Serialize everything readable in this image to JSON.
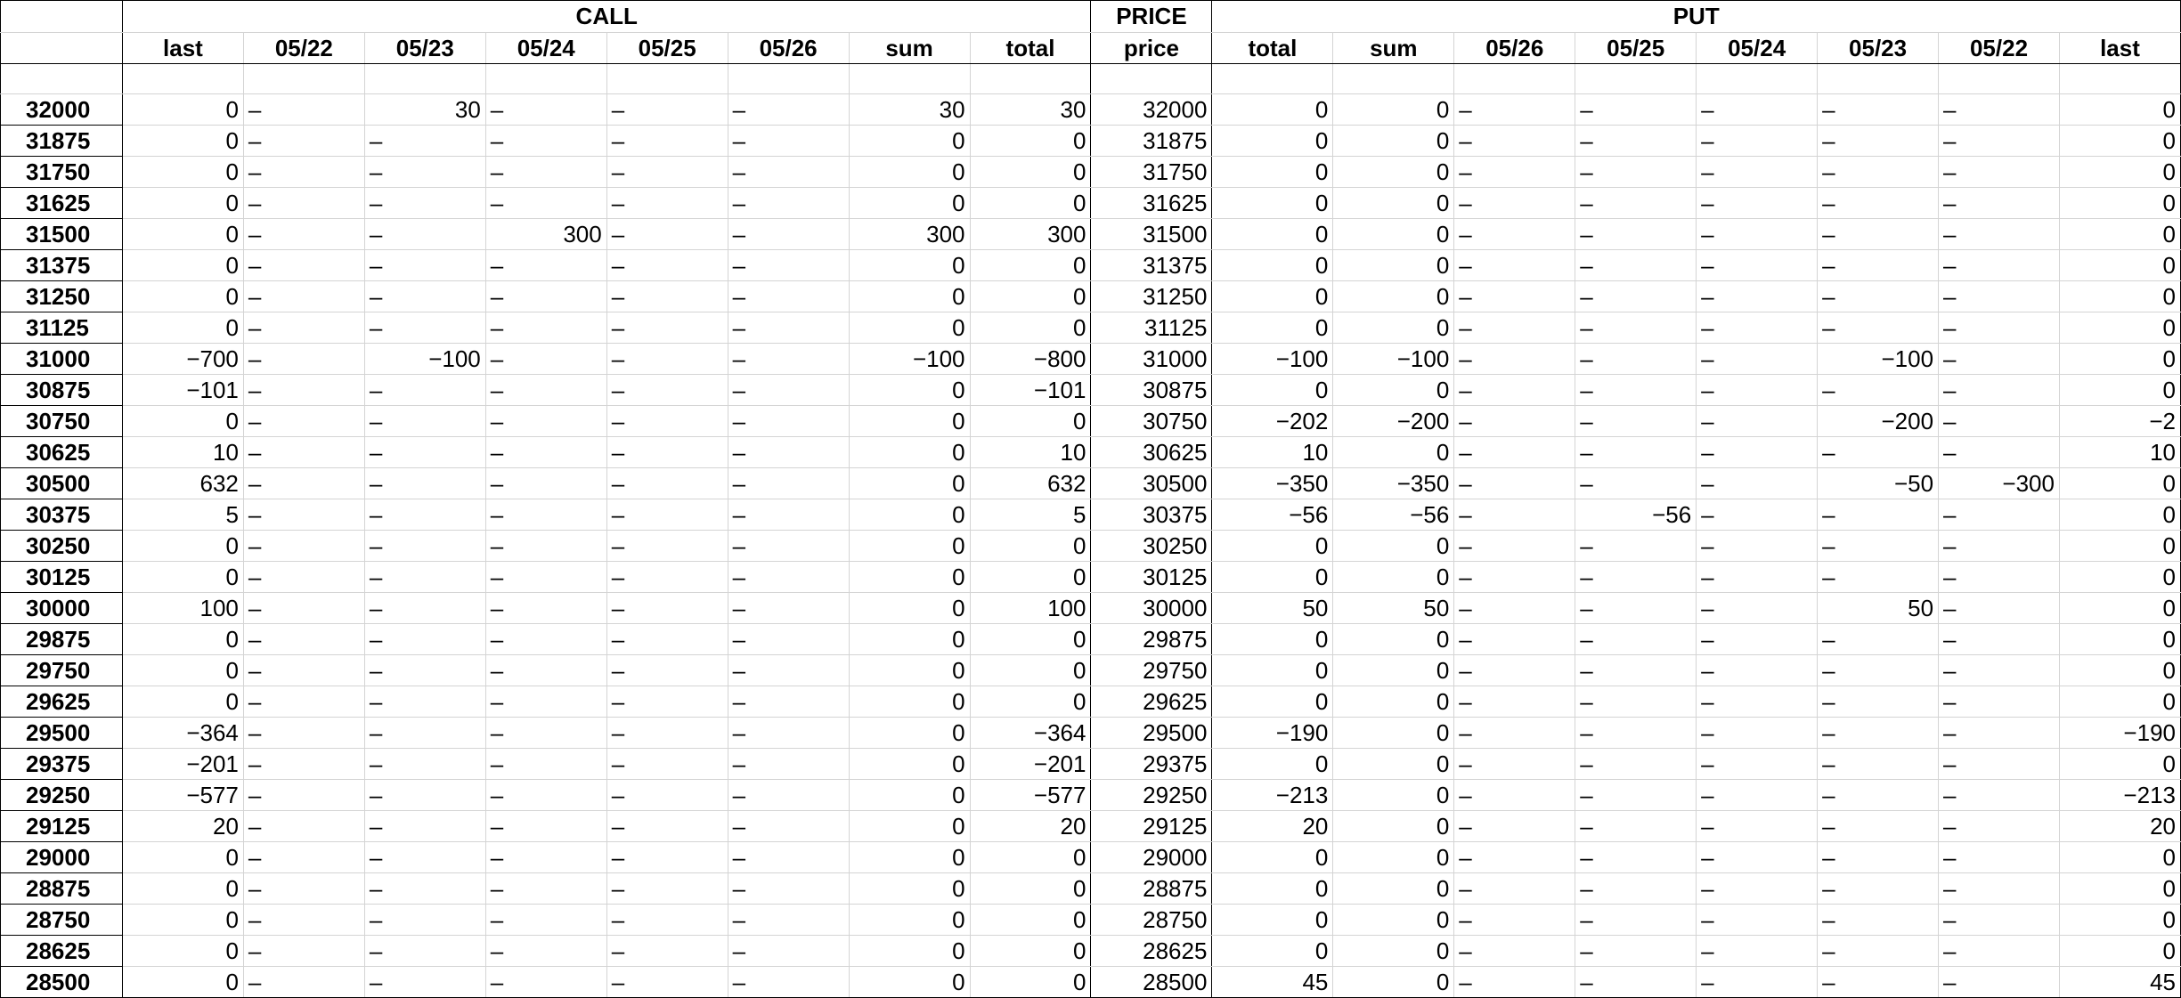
{
  "header": {
    "call_label": "CALL",
    "price_label": "PRICE",
    "put_label": "PUT"
  },
  "columns": [
    "",
    "last",
    "05/22",
    "05/23",
    "05/24",
    "05/25",
    "05/26",
    "sum",
    "total",
    "price",
    "total",
    "sum",
    "05/26",
    "05/25",
    "05/24",
    "05/23",
    "05/22",
    "last"
  ],
  "dash": "–",
  "rows": [
    [
      "32000",
      "0",
      "–",
      "30",
      "–",
      "–",
      "–",
      "30",
      "30",
      "32000",
      "0",
      "0",
      "–",
      "–",
      "–",
      "–",
      "–",
      "0"
    ],
    [
      "31875",
      "0",
      "–",
      "–",
      "–",
      "–",
      "–",
      "0",
      "0",
      "31875",
      "0",
      "0",
      "–",
      "–",
      "–",
      "–",
      "–",
      "0"
    ],
    [
      "31750",
      "0",
      "–",
      "–",
      "–",
      "–",
      "–",
      "0",
      "0",
      "31750",
      "0",
      "0",
      "–",
      "–",
      "–",
      "–",
      "–",
      "0"
    ],
    [
      "31625",
      "0",
      "–",
      "–",
      "–",
      "–",
      "–",
      "0",
      "0",
      "31625",
      "0",
      "0",
      "–",
      "–",
      "–",
      "–",
      "–",
      "0"
    ],
    [
      "31500",
      "0",
      "–",
      "–",
      "300",
      "–",
      "–",
      "300",
      "300",
      "31500",
      "0",
      "0",
      "–",
      "–",
      "–",
      "–",
      "–",
      "0"
    ],
    [
      "31375",
      "0",
      "–",
      "–",
      "–",
      "–",
      "–",
      "0",
      "0",
      "31375",
      "0",
      "0",
      "–",
      "–",
      "–",
      "–",
      "–",
      "0"
    ],
    [
      "31250",
      "0",
      "–",
      "–",
      "–",
      "–",
      "–",
      "0",
      "0",
      "31250",
      "0",
      "0",
      "–",
      "–",
      "–",
      "–",
      "–",
      "0"
    ],
    [
      "31125",
      "0",
      "–",
      "–",
      "–",
      "–",
      "–",
      "0",
      "0",
      "31125",
      "0",
      "0",
      "–",
      "–",
      "–",
      "–",
      "–",
      "0"
    ],
    [
      "31000",
      "−700",
      "–",
      "−100",
      "–",
      "–",
      "–",
      "−100",
      "−800",
      "31000",
      "−100",
      "−100",
      "–",
      "–",
      "–",
      "−100",
      "–",
      "0"
    ],
    [
      "30875",
      "−101",
      "–",
      "–",
      "–",
      "–",
      "–",
      "0",
      "−101",
      "30875",
      "0",
      "0",
      "–",
      "–",
      "–",
      "–",
      "–",
      "0"
    ],
    [
      "30750",
      "0",
      "–",
      "–",
      "–",
      "–",
      "–",
      "0",
      "0",
      "30750",
      "−202",
      "−200",
      "–",
      "–",
      "–",
      "−200",
      "–",
      "−2"
    ],
    [
      "30625",
      "10",
      "–",
      "–",
      "–",
      "–",
      "–",
      "0",
      "10",
      "30625",
      "10",
      "0",
      "–",
      "–",
      "–",
      "–",
      "–",
      "10"
    ],
    [
      "30500",
      "632",
      "–",
      "–",
      "–",
      "–",
      "–",
      "0",
      "632",
      "30500",
      "−350",
      "−350",
      "–",
      "–",
      "–",
      "−50",
      "−300",
      "0"
    ],
    [
      "30375",
      "5",
      "–",
      "–",
      "–",
      "–",
      "–",
      "0",
      "5",
      "30375",
      "−56",
      "−56",
      "–",
      "−56",
      "–",
      "–",
      "–",
      "0"
    ],
    [
      "30250",
      "0",
      "–",
      "–",
      "–",
      "–",
      "–",
      "0",
      "0",
      "30250",
      "0",
      "0",
      "–",
      "–",
      "–",
      "–",
      "–",
      "0"
    ],
    [
      "30125",
      "0",
      "–",
      "–",
      "–",
      "–",
      "–",
      "0",
      "0",
      "30125",
      "0",
      "0",
      "–",
      "–",
      "–",
      "–",
      "–",
      "0"
    ],
    [
      "30000",
      "100",
      "–",
      "–",
      "–",
      "–",
      "–",
      "0",
      "100",
      "30000",
      "50",
      "50",
      "–",
      "–",
      "–",
      "50",
      "–",
      "0"
    ],
    [
      "29875",
      "0",
      "–",
      "–",
      "–",
      "–",
      "–",
      "0",
      "0",
      "29875",
      "0",
      "0",
      "–",
      "–",
      "–",
      "–",
      "–",
      "0"
    ],
    [
      "29750",
      "0",
      "–",
      "–",
      "–",
      "–",
      "–",
      "0",
      "0",
      "29750",
      "0",
      "0",
      "–",
      "–",
      "–",
      "–",
      "–",
      "0"
    ],
    [
      "29625",
      "0",
      "–",
      "–",
      "–",
      "–",
      "–",
      "0",
      "0",
      "29625",
      "0",
      "0",
      "–",
      "–",
      "–",
      "–",
      "–",
      "0"
    ],
    [
      "29500",
      "−364",
      "–",
      "–",
      "–",
      "–",
      "–",
      "0",
      "−364",
      "29500",
      "−190",
      "0",
      "–",
      "–",
      "–",
      "–",
      "–",
      "−190"
    ],
    [
      "29375",
      "−201",
      "–",
      "–",
      "–",
      "–",
      "–",
      "0",
      "−201",
      "29375",
      "0",
      "0",
      "–",
      "–",
      "–",
      "–",
      "–",
      "0"
    ],
    [
      "29250",
      "−577",
      "–",
      "–",
      "–",
      "–",
      "–",
      "0",
      "−577",
      "29250",
      "−213",
      "0",
      "–",
      "–",
      "–",
      "–",
      "–",
      "−213"
    ],
    [
      "29125",
      "20",
      "–",
      "–",
      "–",
      "–",
      "–",
      "0",
      "20",
      "29125",
      "20",
      "0",
      "–",
      "–",
      "–",
      "–",
      "–",
      "20"
    ],
    [
      "29000",
      "0",
      "–",
      "–",
      "–",
      "–",
      "–",
      "0",
      "0",
      "29000",
      "0",
      "0",
      "–",
      "–",
      "–",
      "–",
      "–",
      "0"
    ],
    [
      "28875",
      "0",
      "–",
      "–",
      "–",
      "–",
      "–",
      "0",
      "0",
      "28875",
      "0",
      "0",
      "–",
      "–",
      "–",
      "–",
      "–",
      "0"
    ],
    [
      "28750",
      "0",
      "–",
      "–",
      "–",
      "–",
      "–",
      "0",
      "0",
      "28750",
      "0",
      "0",
      "–",
      "–",
      "–",
      "–",
      "–",
      "0"
    ],
    [
      "28625",
      "0",
      "–",
      "–",
      "–",
      "–",
      "–",
      "0",
      "0",
      "28625",
      "0",
      "0",
      "–",
      "–",
      "–",
      "–",
      "–",
      "0"
    ],
    [
      "28500",
      "0",
      "–",
      "–",
      "–",
      "–",
      "–",
      "0",
      "0",
      "28500",
      "45",
      "0",
      "–",
      "–",
      "–",
      "–",
      "–",
      "45"
    ]
  ]
}
